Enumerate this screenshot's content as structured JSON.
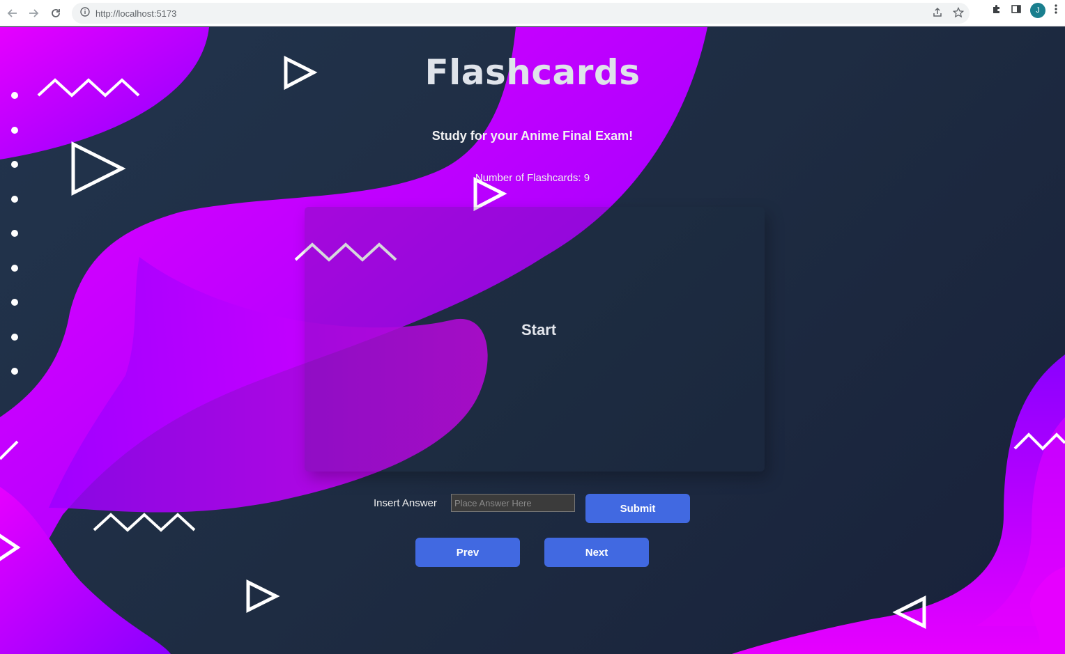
{
  "browser": {
    "url": "http://localhost:5173",
    "avatar_letter": "J",
    "icons": [
      "back-icon",
      "forward-icon",
      "reload-icon",
      "info-icon",
      "share-icon",
      "star-icon",
      "extensions-icon",
      "sidepanel-icon",
      "menu-icon"
    ]
  },
  "page": {
    "title": "Flashcards",
    "subtitle": "Study for your Anime Final Exam!",
    "count_text": "Number of Flashcards: 9",
    "card_text": "Start",
    "answer_label": "Insert Answer",
    "answer_value": "",
    "answer_placeholder": "Place Answer Here",
    "submit_label": "Submit",
    "prev_label": "Prev",
    "next_label": "Next"
  },
  "colors": {
    "button": "#4169e1",
    "magenta": "#e600ff",
    "violet": "#8a00ff",
    "background": "#1e2a3d"
  }
}
